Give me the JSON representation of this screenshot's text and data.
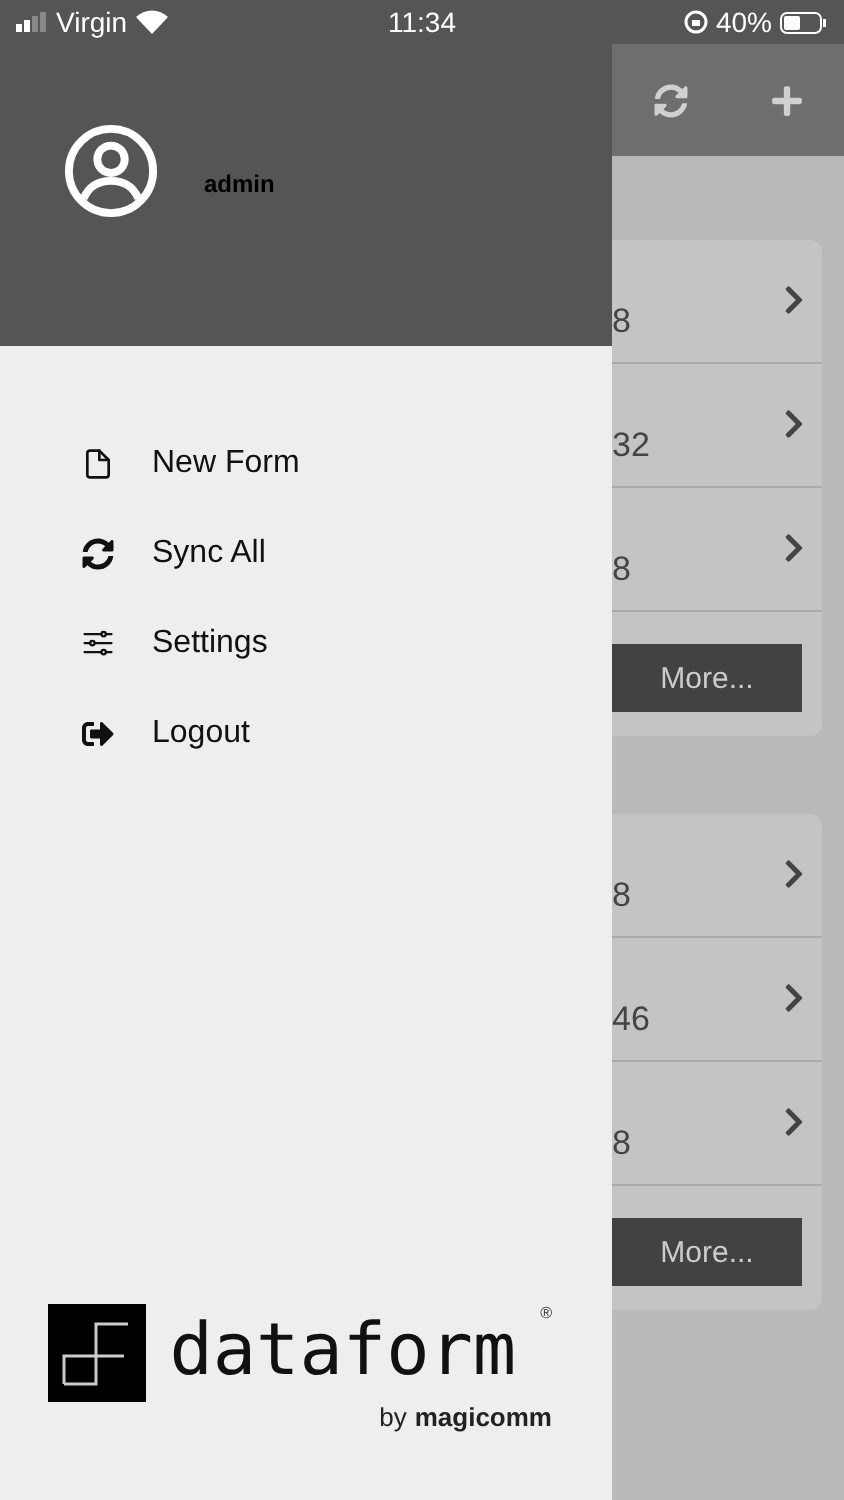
{
  "status_bar": {
    "carrier": "Virgin",
    "time": "11:34",
    "battery": "40%"
  },
  "drawer": {
    "user": "admin",
    "menu": [
      {
        "kind": "new",
        "label": "New Form"
      },
      {
        "kind": "sync",
        "label": "Sync All"
      },
      {
        "kind": "settings",
        "label": "Settings"
      },
      {
        "kind": "logout",
        "label": "Logout"
      }
    ],
    "logo": {
      "name": "dataform",
      "mark": "®",
      "byline": "by",
      "company": "magicomm"
    }
  },
  "background": {
    "groups": [
      {
        "rows": [
          "8",
          "32",
          "8"
        ],
        "more": "More..."
      },
      {
        "rows": [
          "8",
          "46",
          "8"
        ],
        "more": "More..."
      }
    ]
  }
}
